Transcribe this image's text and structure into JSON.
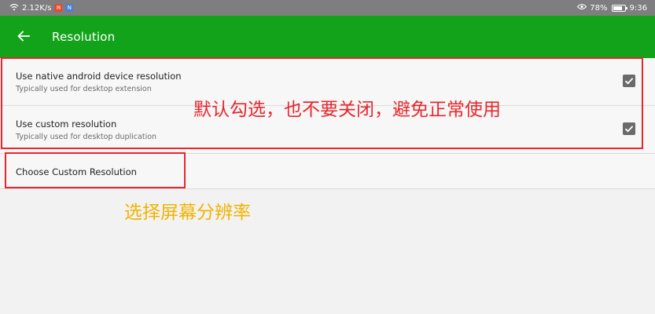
{
  "status_bar": {
    "net_speed": "2.12K/s",
    "badge1": "✉",
    "badge2": "N",
    "battery_percent": "78%",
    "battery_level": 0.78,
    "time": "9:36"
  },
  "app_bar": {
    "title": "Resolution"
  },
  "preferences": [
    {
      "title": "Use native android device resolution",
      "summary": "Typically used for desktop extension",
      "checked": true
    },
    {
      "title": "Use custom resolution",
      "summary": "Typically used for desktop duplication",
      "checked": true
    },
    {
      "title": "Choose Custom Resolution"
    }
  ],
  "annotations": {
    "note_checked": "默认勾选，也不要关闭，避免正常使用",
    "note_choose": "选择屏幕分辨率"
  },
  "colors": {
    "app_bar": "#12a31a",
    "annotation_red": "#e8262c",
    "annotation_yellow": "#f0b400"
  }
}
